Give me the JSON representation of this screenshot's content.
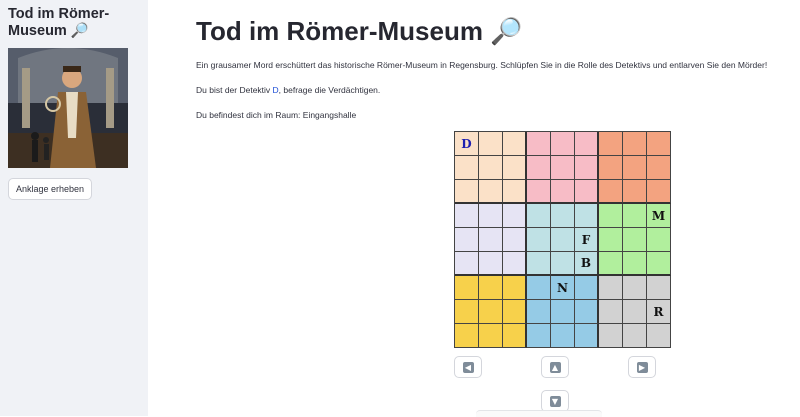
{
  "sidebar": {
    "title": "Tod im Römer-Museum 🔎",
    "accuse_button": "Anklage erheben"
  },
  "main": {
    "title": "Tod im Römer-Museum 🔎",
    "intro": "Ein grausamer Mord erschüttert das historische Römer-Museum in Regensburg. Schlüpfen Sie in die Rolle des Detektivs und entlarven Sie den Mörder!",
    "detective_prefix": "Du bist der Detektiv ",
    "detective_letter": "D",
    "detective_suffix": ", befrage die Verdächtigen.",
    "room_text": "Du befindest dich im Raum: Eingangshalle"
  },
  "board": {
    "room_colors": [
      [
        "#fbe1c8",
        "#f7bcc6",
        "#f3a380"
      ],
      [
        "#e6e4f4",
        "#bfe1e5",
        "#b1ef9d"
      ],
      [
        "#f7d14b",
        "#95cbe6",
        "#d2d2d2"
      ]
    ],
    "pieces": [
      {
        "letter": "D",
        "row": 0,
        "col": 0,
        "is_detective": true
      },
      {
        "letter": "M",
        "row": 3,
        "col": 8
      },
      {
        "letter": "F",
        "row": 4,
        "col": 5
      },
      {
        "letter": "B",
        "row": 5,
        "col": 5
      },
      {
        "letter": "N",
        "row": 6,
        "col": 4
      },
      {
        "letter": "R",
        "row": 7,
        "col": 8
      }
    ]
  },
  "controls": {
    "left_icon": "arrow-left-icon",
    "up_icon": "arrow-up-icon",
    "right_icon": "arrow-right-icon",
    "down_icon": "arrow-down-icon"
  }
}
